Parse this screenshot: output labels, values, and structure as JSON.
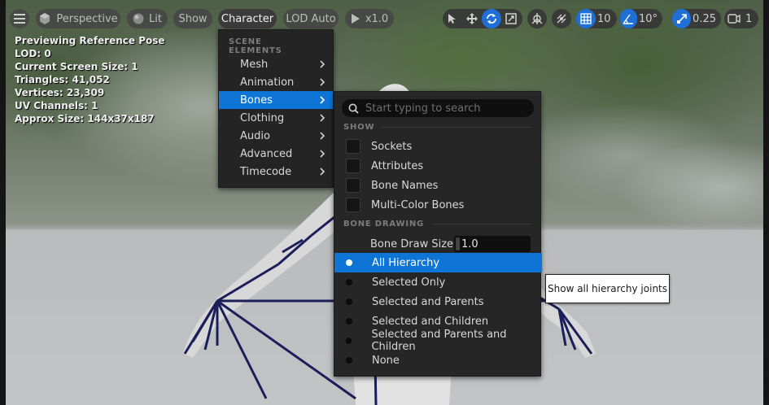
{
  "toolbar": {
    "view_mode": "Perspective",
    "lighting": "Lit",
    "show": "Show",
    "character": "Character",
    "lod": "LOD Auto",
    "play_speed": "x1.0",
    "grid_snap": "10",
    "rotation_snap": "10°",
    "scale_snap": "0.25",
    "camera_count": "1"
  },
  "stats": {
    "line1": "Previewing Reference Pose",
    "line2": "LOD: 0",
    "line3": "Current Screen Size: 1",
    "line4": "Triangles: 41,052",
    "line5": "Vertices: 23,309",
    "line6": "UV Channels: 1",
    "line7": "Approx Size: 144x37x187"
  },
  "character_menu": {
    "section": "SCENE ELEMENTS",
    "items": [
      {
        "label": "Mesh"
      },
      {
        "label": "Animation"
      },
      {
        "label": "Bones"
      },
      {
        "label": "Clothing"
      },
      {
        "label": "Audio"
      },
      {
        "label": "Advanced"
      },
      {
        "label": "Timecode"
      }
    ],
    "selected": "Bones"
  },
  "bones_menu": {
    "search_placeholder": "Start typing to search",
    "show_section": "SHOW",
    "checkboxes": [
      {
        "label": "Sockets",
        "checked": false
      },
      {
        "label": "Attributes",
        "checked": false
      },
      {
        "label": "Bone Names",
        "checked": false
      },
      {
        "label": "Multi-Color Bones",
        "checked": false
      }
    ],
    "drawing_section": "BONE DRAWING",
    "draw_size_label": "Bone Draw Size:",
    "draw_size_value": "1.0",
    "radios": [
      {
        "label": "All Hierarchy"
      },
      {
        "label": "Selected Only"
      },
      {
        "label": "Selected and Parents"
      },
      {
        "label": "Selected and Children"
      },
      {
        "label": "Selected and Parents and Children"
      },
      {
        "label": "None"
      }
    ],
    "selected_radio": "All Hierarchy"
  },
  "tooltip": "Show all hierarchy joints",
  "colors": {
    "accent": "#0e74d6",
    "bone_lines": "#1a1f5a"
  }
}
